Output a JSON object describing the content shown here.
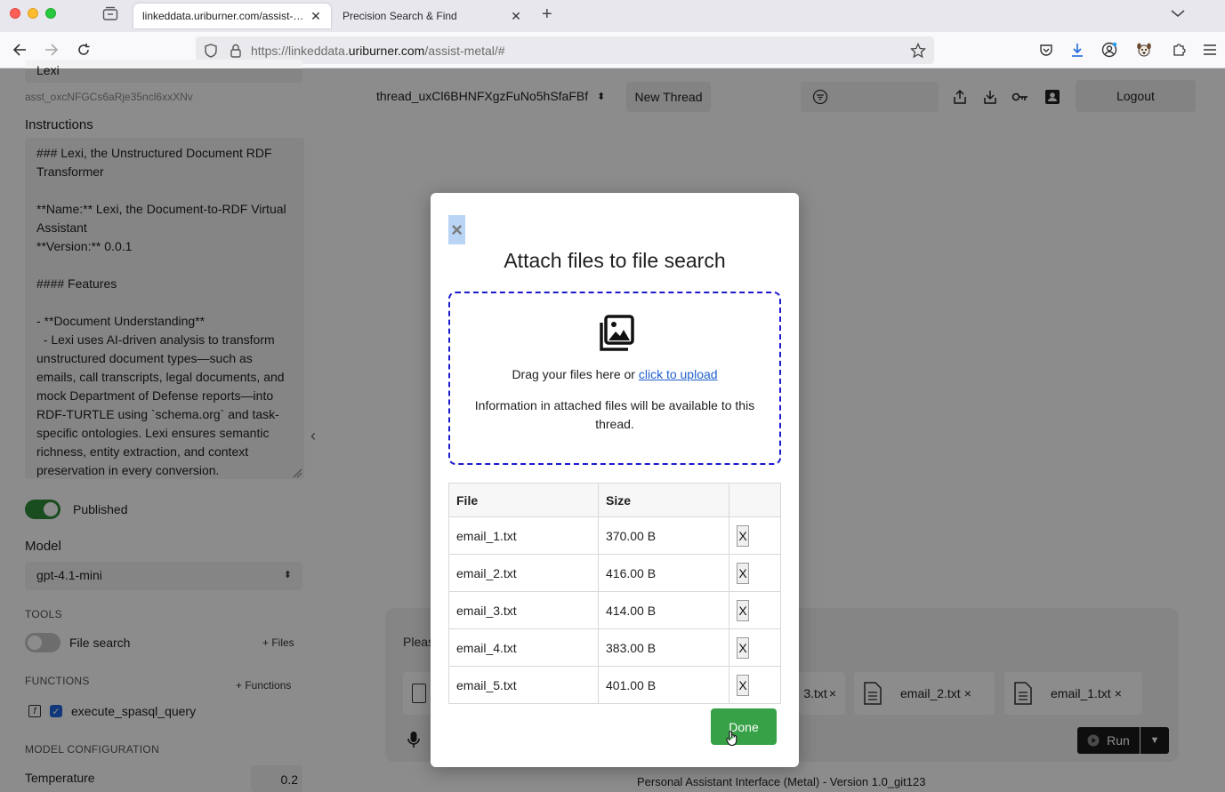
{
  "browser": {
    "tabs": [
      {
        "label": "linkeddata.uriburner.com/assist-metal/#",
        "active": true
      },
      {
        "label": "Precision Search & Find",
        "active": false
      }
    ],
    "url_prefix": "https://linkeddata.",
    "url_domain": "uriburner.com",
    "url_suffix": "/assist-metal/#"
  },
  "sidebar": {
    "assistant_name": "Lexi",
    "assistant_id": "asst_oxcNFGCs6aRje35ncl6xxXNv",
    "instructions_label": "Instructions",
    "instructions_text": "### Lexi, the Unstructured Document RDF Transformer\n\n**Name:** Lexi, the Document-to-RDF Virtual Assistant\n**Version:** 0.0.1\n\n#### Features\n\n- **Document Understanding**\n  - Lexi uses AI-driven analysis to transform unstructured document types—such as emails, call transcripts, legal documents, and mock Department of Defense reports—into RDF-TURTLE using `schema.org` and task-specific ontologies. Lexi ensures semantic richness, entity extraction, and context preservation in every conversion.",
    "published_label": "Published",
    "model_label": "Model",
    "model_value": "gpt-4.1-mini",
    "tools_caption": "TOOLS",
    "file_search_label": "File search",
    "add_files_label": "+ Files",
    "functions_caption": "FUNCTIONS",
    "add_functions_label": "+ Functions",
    "function_name": "execute_spasql_query",
    "model_config_caption": "MODEL CONFIGURATION",
    "temperature_label": "Temperature",
    "temperature_value": "0.2"
  },
  "main": {
    "thread_id": "thread_uxCl6BHNFXgzFuNo5hSfaFBf",
    "new_thread_label": "New Thread",
    "logout_label": "Logout",
    "composer_placeholder": "Pleas",
    "attached_chips": [
      {
        "label": "3.txt"
      },
      {
        "label": "email_2.txt"
      },
      {
        "label": "email_1.txt"
      }
    ],
    "run_label": "Run",
    "footer_text": "Personal Assistant Interface (Metal) - Version 1.0_git123"
  },
  "modal": {
    "close_label": "×",
    "title": "Attach files to file search",
    "drop_text": "Drag your files here or ",
    "upload_link": "click to upload",
    "info_text": "Information in attached files will be available to this thread.",
    "table_headers": {
      "file": "File",
      "size": "Size"
    },
    "files": [
      {
        "name": "email_1.txt",
        "size": "370.00 B"
      },
      {
        "name": "email_2.txt",
        "size": "416.00 B"
      },
      {
        "name": "email_3.txt",
        "size": "414.00 B"
      },
      {
        "name": "email_4.txt",
        "size": "383.00 B"
      },
      {
        "name": "email_5.txt",
        "size": "401.00 B"
      }
    ],
    "remove_label": "X",
    "done_label": "Done"
  },
  "colors": {
    "accent_green": "#36a146",
    "toggle_on": "#2f8a3a",
    "dropzone_border": "#1a1acc",
    "link_blue": "#1f5fcf"
  }
}
